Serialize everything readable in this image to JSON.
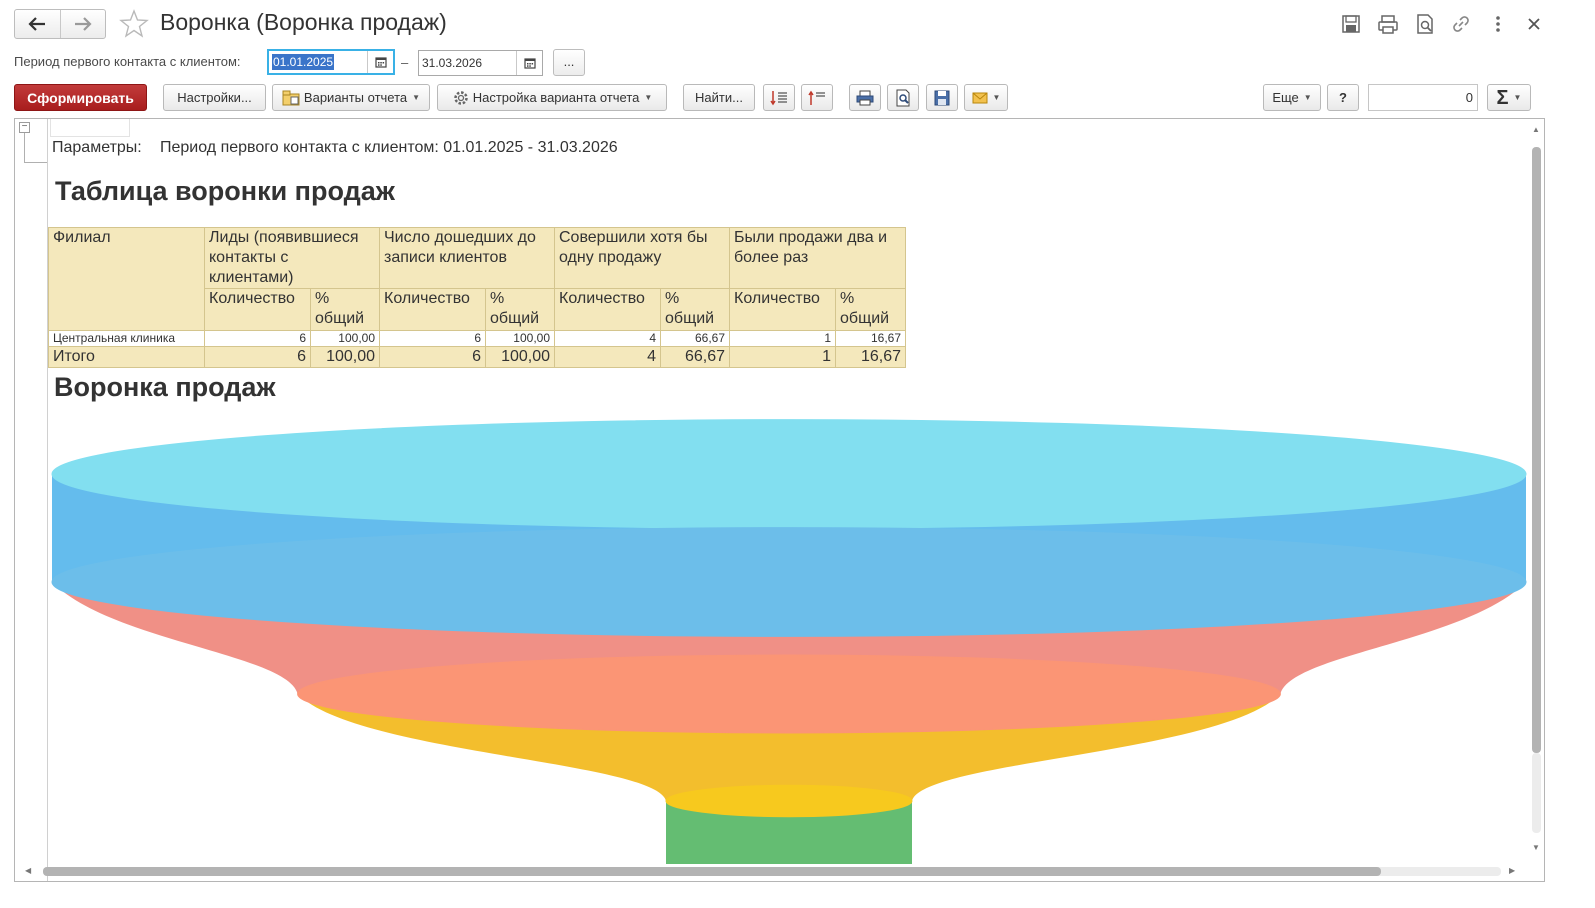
{
  "window": {
    "title": "Воронка (Воронка продаж)",
    "back_icon": "arrow-left",
    "forward_icon": "arrow-right",
    "favorite_icon": "star",
    "top_icons": [
      "save-icon",
      "print-icon",
      "preview-icon",
      "link-icon",
      "more-icon",
      "close-icon"
    ]
  },
  "period": {
    "label": "Период первого контакта с клиентом:",
    "date_from": "01.01.2025",
    "separator": "–",
    "date_to": "31.03.2026",
    "more_label": "..."
  },
  "toolbar": {
    "generate": "Сформировать",
    "settings": "Настройки...",
    "variants": "Варианты отчета",
    "variant_settings": "Настройка варианта отчета",
    "find": "Найти...",
    "more": "Еще",
    "help": "?",
    "sum_value": "0",
    "sum_symbol": "Σ"
  },
  "report": {
    "params_key": "Параметры:",
    "params_value": "Период первого контакта с клиентом: 01.01.2025 - 31.03.2026",
    "table_title": "Таблица воронки продаж",
    "chart_title": "Воронка продаж",
    "table": {
      "branch_header": "Филиал",
      "group_headers": [
        "Лиды (появившиеся контакты с клиентами)",
        "Число дошедших до записи клиентов",
        "Совершили хотя бы одну продажу",
        "Были продажи два и более раз"
      ],
      "qty_header": "Количество",
      "pct_header": "% общий",
      "rows": [
        {
          "branch": "Центральная клиника",
          "values": [
            "6",
            "100,00",
            "6",
            "100,00",
            "4",
            "66,67",
            "1",
            "16,67"
          ]
        }
      ],
      "total": {
        "label": "Итого",
        "values": [
          "6",
          "100,00",
          "6",
          "100,00",
          "4",
          "66,67",
          "1",
          "16,67"
        ]
      }
    }
  },
  "chart_data": {
    "type": "funnel",
    "title": "Воронка продаж",
    "categories": [
      "Лиды (появившиеся контакты с клиентами)",
      "Число дошедших до записи клиентов",
      "Совершили хотя бы одну продажу",
      "Были продажи два и более раз"
    ],
    "values": [
      6,
      6,
      4,
      1
    ],
    "colors": [
      "#5cb8ec",
      "#ef8a80",
      "#f2bb22",
      "#5cb96a"
    ],
    "top_colors": [
      "#82dff0",
      "#6cbeea",
      "#fb9575",
      "#f7c91e"
    ]
  }
}
